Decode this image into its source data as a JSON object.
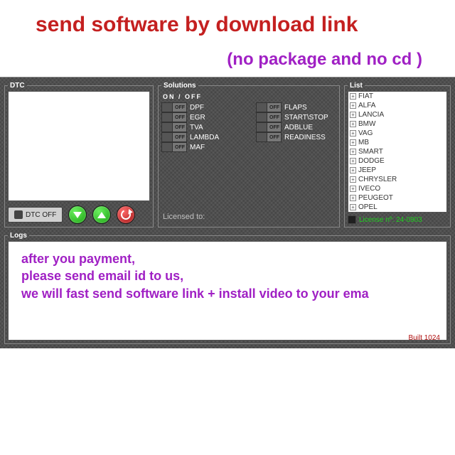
{
  "promo": {
    "title": "send software by download link",
    "subtitle": "(no package and no cd )"
  },
  "dtc": {
    "legend": "DTC",
    "off_button_label": "DTC OFF"
  },
  "solutions": {
    "legend": "Solutions",
    "header": "ON / OFF",
    "toggle_off_text": "OFF",
    "col1": [
      {
        "label": "DPF"
      },
      {
        "label": "EGR"
      },
      {
        "label": "TVA"
      },
      {
        "label": "LAMBDA"
      },
      {
        "label": "MAF"
      }
    ],
    "col2": [
      {
        "label": "FLAPS"
      },
      {
        "label": "START\\STOP"
      },
      {
        "label": "ADBLUE"
      },
      {
        "label": "READINESS"
      }
    ],
    "licensed_to": "Licensed to:"
  },
  "list": {
    "legend": "List",
    "items": [
      "FIAT",
      "ALFA",
      "LANCIA",
      "BMW",
      "VAG",
      "MB",
      "SMART",
      "DODGE",
      "JEEP",
      "CHRYSLER",
      "IVECO",
      "PEUGEOT",
      "OPEL"
    ],
    "license_text": "License nº: 24-0903"
  },
  "logs": {
    "legend": "Logs",
    "lines": [
      "after you payment,",
      "please send email id to us,",
      "we will fast send software link + install video to your ema"
    ]
  },
  "build": "Built 1024",
  "icons": {
    "tree_plus": "+"
  }
}
